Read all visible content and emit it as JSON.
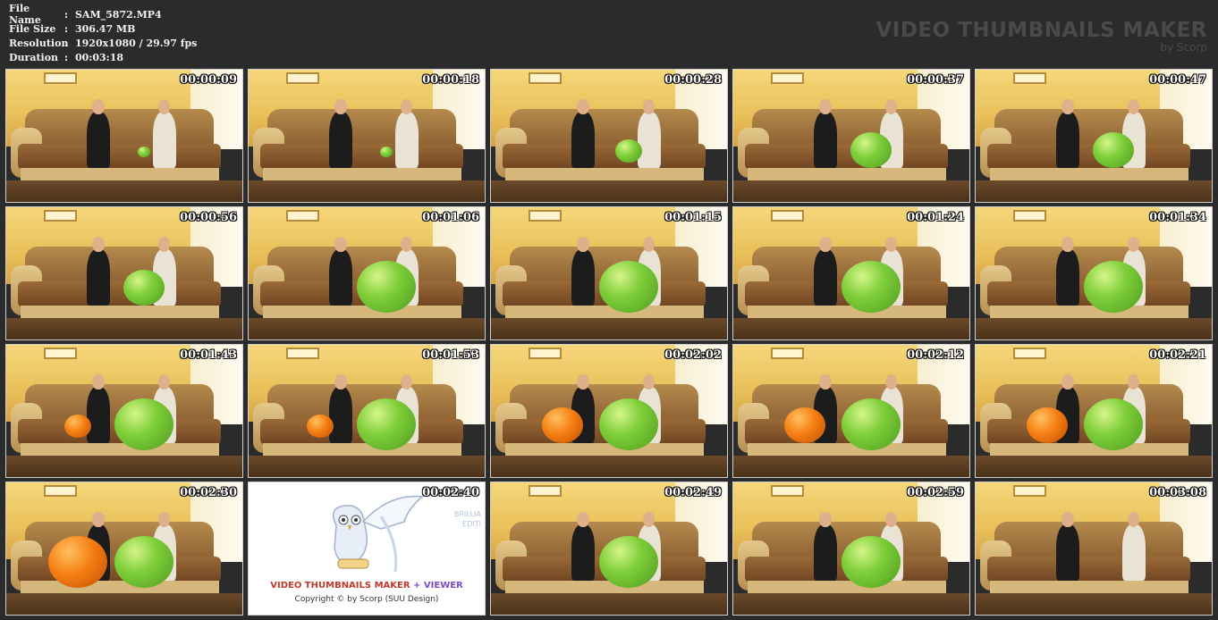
{
  "meta": {
    "rows": [
      {
        "key": "File Name",
        "sep": ":",
        "value": "SAM_5872.MP4"
      },
      {
        "key": "File Size",
        "sep": ":",
        "value": "306.47 MB"
      },
      {
        "key": "Resolution",
        "sep": ":",
        "value": "1920x1080 / 29.97 fps"
      },
      {
        "key": "Duration",
        "sep": ":",
        "value": "00:03:18"
      }
    ]
  },
  "brand": {
    "title": "VIDEO THUMBNAILS MAKER",
    "sub": "by Scorp"
  },
  "thumbnails": [
    {
      "time": "00:00:09",
      "balloons": [
        {
          "color": "green",
          "size": "tiny"
        }
      ]
    },
    {
      "time": "00:00:18",
      "balloons": [
        {
          "color": "green",
          "size": "tiny"
        }
      ]
    },
    {
      "time": "00:00:28",
      "balloons": [
        {
          "color": "green",
          "size": "small"
        }
      ]
    },
    {
      "time": "00:00:37",
      "balloons": [
        {
          "color": "green",
          "size": "medium"
        }
      ]
    },
    {
      "time": "00:00:47",
      "balloons": [
        {
          "color": "green",
          "size": "medium"
        }
      ]
    },
    {
      "time": "00:00:56",
      "balloons": [
        {
          "color": "green",
          "size": "medium"
        }
      ]
    },
    {
      "time": "00:01:06",
      "balloons": [
        {
          "color": "green",
          "size": "large"
        }
      ]
    },
    {
      "time": "00:01:15",
      "balloons": [
        {
          "color": "green",
          "size": "large"
        }
      ]
    },
    {
      "time": "00:01:24",
      "balloons": [
        {
          "color": "green",
          "size": "large"
        }
      ]
    },
    {
      "time": "00:01:34",
      "balloons": [
        {
          "color": "green",
          "size": "large"
        }
      ]
    },
    {
      "time": "00:01:43",
      "balloons": [
        {
          "color": "orange",
          "size": "small"
        },
        {
          "color": "green",
          "size": "large"
        }
      ]
    },
    {
      "time": "00:01:53",
      "balloons": [
        {
          "color": "orange",
          "size": "small"
        },
        {
          "color": "green",
          "size": "large"
        }
      ]
    },
    {
      "time": "00:02:02",
      "balloons": [
        {
          "color": "orange",
          "size": "medium"
        },
        {
          "color": "green",
          "size": "large"
        }
      ]
    },
    {
      "time": "00:02:12",
      "balloons": [
        {
          "color": "orange",
          "size": "medium"
        },
        {
          "color": "green",
          "size": "large"
        }
      ]
    },
    {
      "time": "00:02:21",
      "balloons": [
        {
          "color": "orange",
          "size": "medium"
        },
        {
          "color": "green",
          "size": "large"
        }
      ]
    },
    {
      "time": "00:02:30",
      "balloons": [
        {
          "color": "orange",
          "size": "large"
        },
        {
          "color": "green",
          "size": "large"
        }
      ]
    },
    {
      "time": "00:02:40",
      "promo": true
    },
    {
      "time": "00:02:49",
      "balloons": [
        {
          "color": "green",
          "size": "large"
        }
      ]
    },
    {
      "time": "00:02:59",
      "balloons": [
        {
          "color": "green",
          "size": "large"
        }
      ]
    },
    {
      "time": "00:03:08",
      "balloons": []
    }
  ],
  "promo": {
    "title_main": "VIDEO THUMBNAILS MAKER",
    "title_plus": "+ VIEWER",
    "copyright": "Copyright © by Scorp (SUU Design)",
    "side_text_1": "BRILLIA",
    "side_text_2": "EDITI"
  },
  "colors": {
    "background": "#2b2b2b",
    "brand_text": "#4a4a4a",
    "balloon_green": "#7fcf3a",
    "balloon_orange": "#f57e12"
  }
}
